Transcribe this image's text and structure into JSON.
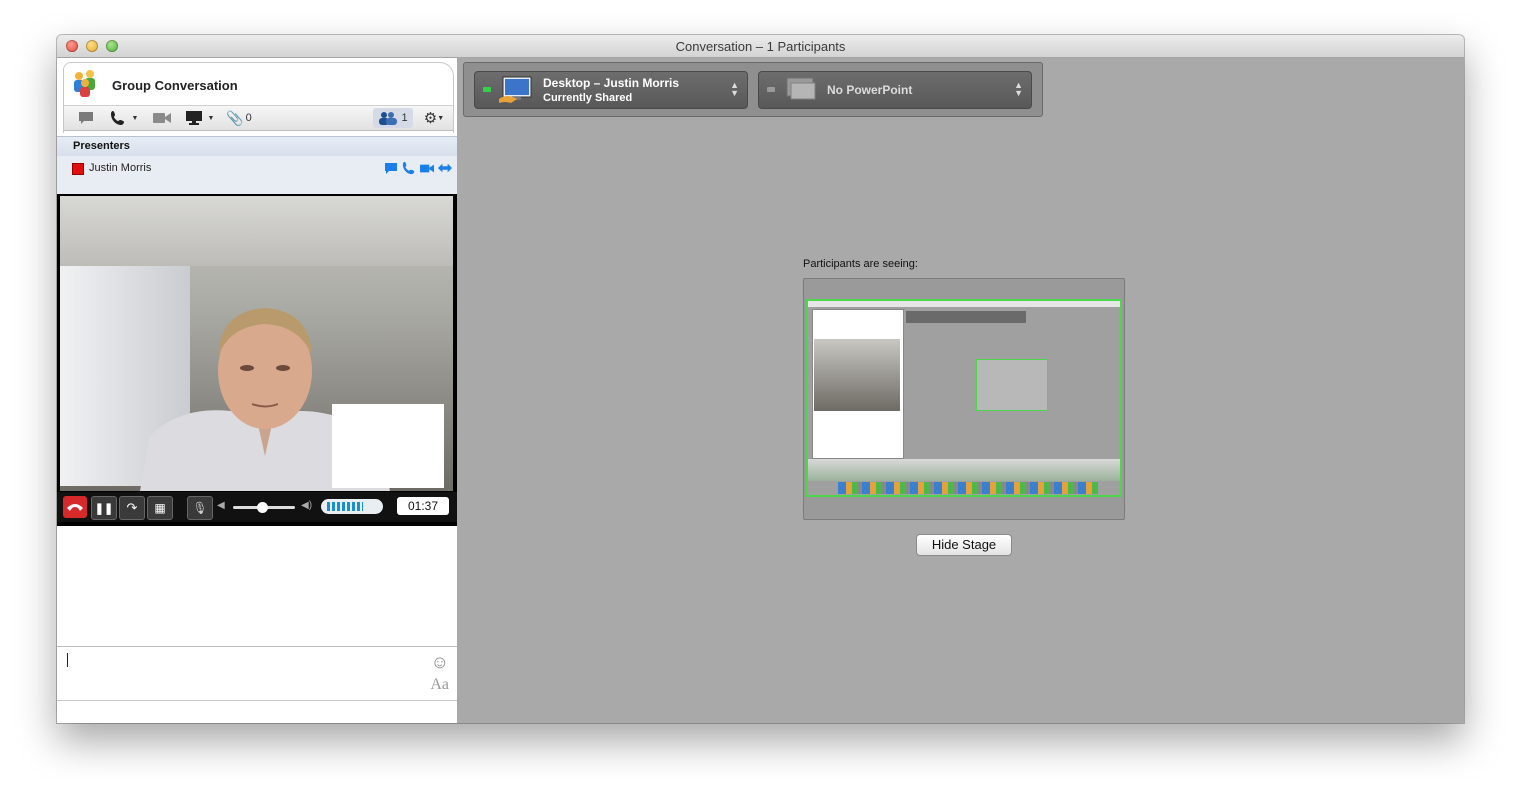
{
  "window": {
    "title": "Conversation – 1 Participants"
  },
  "conversation": {
    "title": "Group Conversation",
    "toolbar": {
      "attachments_count": "0",
      "participants_count": "1"
    }
  },
  "presenters": {
    "header": "Presenters",
    "items": [
      {
        "name": "Justin Morris",
        "status_color": "#e01010"
      }
    ]
  },
  "video": {
    "timer": "01:37"
  },
  "compose": {
    "font_label": "Aa"
  },
  "shares": {
    "desktop": {
      "title": "Desktop – Justin Morris",
      "status": "Currently Shared"
    },
    "powerpoint": {
      "title": "No PowerPoint"
    }
  },
  "stage": {
    "seeing_label": "Participants are seeing:",
    "hide_button": "Hide Stage"
  },
  "colors": {
    "accent_blue": "#1a7fe8",
    "share_active_green": "#35d04a",
    "stage_border_green": "#4cd64c"
  }
}
